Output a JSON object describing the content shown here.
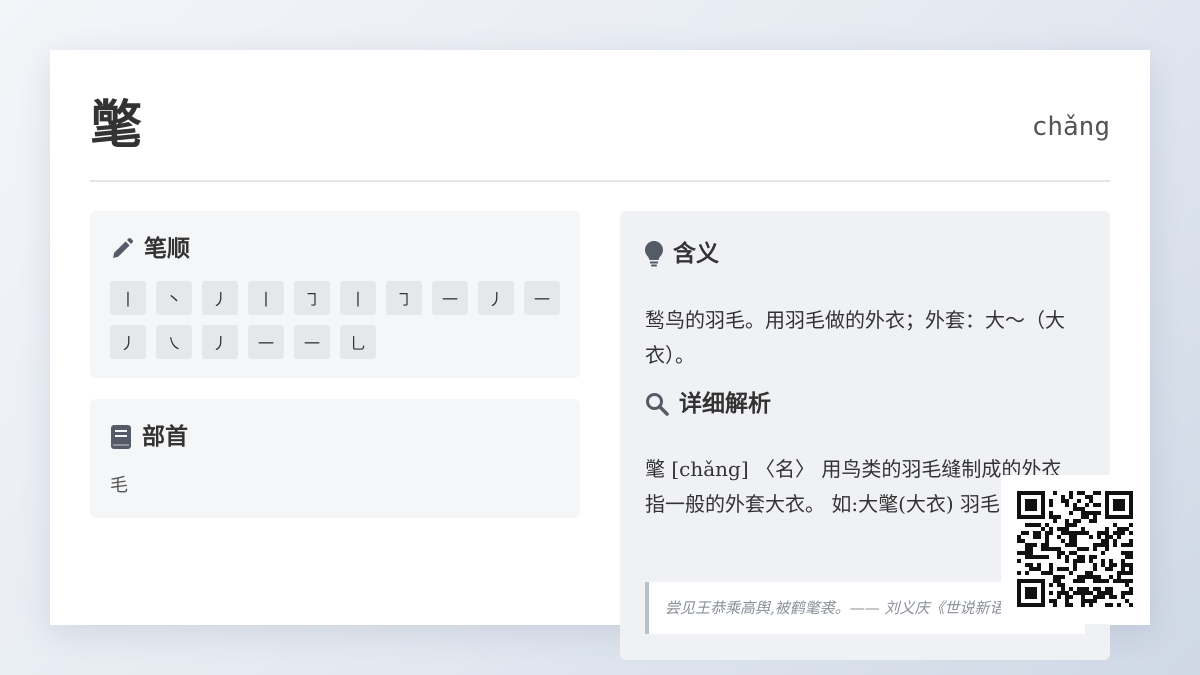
{
  "character": "氅",
  "pinyin": "chǎng",
  "strokes": {
    "title": "笔顺",
    "items": [
      "丨",
      "丶",
      "丿",
      "丨",
      "㇆",
      "丨",
      "㇆",
      "一",
      "丿",
      "一",
      "丿",
      "㇏",
      "丿",
      "一",
      "一",
      "乚"
    ]
  },
  "radical": {
    "title": "部首",
    "value": "毛"
  },
  "meaning": {
    "title": "含义",
    "text": "鹙鸟的羽毛。用羽毛做的外衣；外套：大～（大衣）。"
  },
  "detail": {
    "title": "详细解析",
    "text": "氅 [chǎng] 〈名〉 用鸟类的羽毛缝制成的外衣 指一般的外套大衣。 如:大氅(大衣) 羽毛",
    "quote": "尝见王恭乘高舆,被鹤氅裘。—— 刘义庆《世说新语》"
  },
  "icons": {
    "strokes": "pencil-icon",
    "radical": "book-icon",
    "meaning": "lightbulb-icon",
    "detail": "search-icon",
    "qr": "qr-code"
  },
  "colors": {
    "text": "#333333",
    "panel": "#f5f6f8",
    "stroke_tile": "#e5e7ea",
    "icon": "#555b66"
  }
}
